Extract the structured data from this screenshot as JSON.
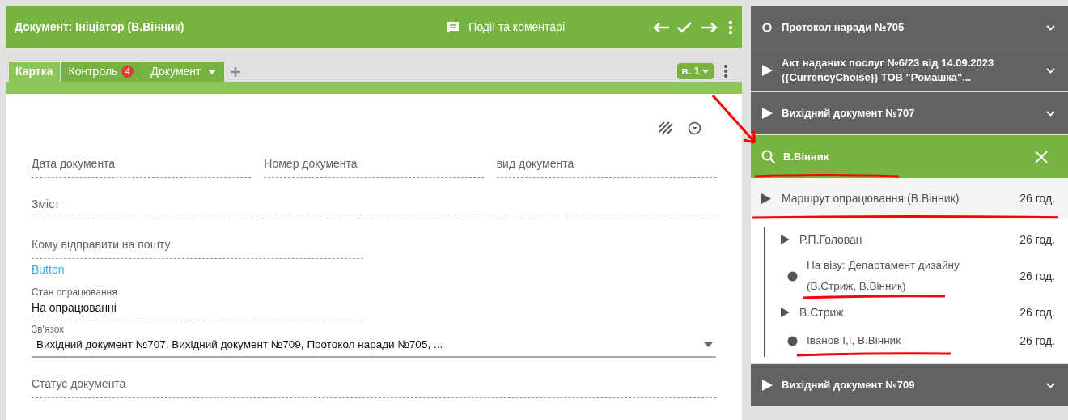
{
  "header": {
    "title": "Документ: Ініціатор (В.Вінник)",
    "events_label": "Події та коментарі"
  },
  "tabs": [
    {
      "label": "Картка",
      "selected": true,
      "dropdown": false
    },
    {
      "label": "Контроль",
      "badge": "4",
      "selected": false,
      "dropdown": false
    },
    {
      "label": "Документ",
      "selected": false,
      "dropdown": true
    }
  ],
  "version": "в. 1",
  "form_rows": [
    [
      {
        "kind": "line",
        "label": "Дата документа"
      },
      {
        "kind": "line",
        "label": "Номер документа"
      },
      {
        "kind": "line",
        "label": "вид документа"
      }
    ],
    [
      {
        "kind": "line",
        "label": "Зміст"
      }
    ],
    [
      {
        "kind": "line",
        "label": "Кому відправити на пошту",
        "half": true
      }
    ],
    [
      {
        "kind": "link",
        "label": "Button"
      }
    ],
    [
      {
        "kind": "value",
        "label": "Стан опрацювання",
        "value": "На опрацюванні",
        "half": true
      }
    ],
    [
      {
        "kind": "select",
        "label": "Зв'язок",
        "value": "Вихідний документ №707,  Вихідний документ №709,  Протокол наради №705,   ..."
      }
    ],
    [
      {
        "kind": "line",
        "label": "Статус документа"
      }
    ]
  ],
  "right_panel": {
    "documents_top": [
      {
        "kind": "ring",
        "title": "Протокол наради №705"
      },
      {
        "kind": "arrow",
        "title": "Акт наданих послуг №6/23 від 14.09.2023 ({CurrencyChoise}) ТОВ \"Ромашка\"..."
      },
      {
        "kind": "arrow",
        "title": "Вихідний документ №707"
      }
    ],
    "search": {
      "value": "В.Вінник"
    },
    "route": {
      "title": "Маршрут опрацювання (В.Вінник)",
      "time": "26 год.",
      "children": [
        {
          "label": "Р.П.Голован",
          "time": "26 год.",
          "children": [
            {
              "label": "На візу: Департамент дизайну (В.Стриж, В.Вінник)",
              "time": "26 год."
            }
          ]
        },
        {
          "label": "В.Стриж",
          "time": "26 год.",
          "children": [
            {
              "label": "Іванов І,І, В.Вінник",
              "time": "26 год."
            }
          ]
        }
      ]
    },
    "documents_bottom": [
      {
        "kind": "arrow",
        "title": "Вихідний документ №709"
      }
    ]
  }
}
